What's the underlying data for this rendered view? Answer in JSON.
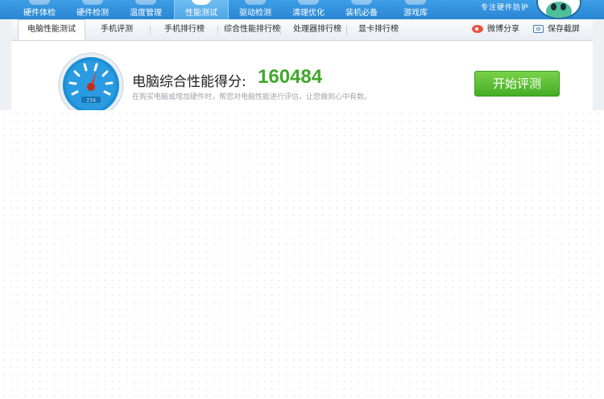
{
  "nav": {
    "items": [
      {
        "label": "硬件体检",
        "icon": "monitor-icon"
      },
      {
        "label": "硬件检测",
        "icon": "hardware-icon"
      },
      {
        "label": "温度管理",
        "icon": "thermometer-icon"
      },
      {
        "label": "性能测试",
        "icon": "speedometer-icon",
        "active": true
      },
      {
        "label": "驱动检测",
        "icon": "driver-icon"
      },
      {
        "label": "清理优化",
        "icon": "broom-icon"
      },
      {
        "label": "装机必备",
        "icon": "shield-icon"
      },
      {
        "label": "游戏库",
        "icon": "gamepad-icon"
      }
    ],
    "slogan": "专注硬件防护",
    "mascot_icon": "mascot-icon"
  },
  "tabs": {
    "items": [
      {
        "label": "电脑性能测试",
        "active": true
      },
      {
        "label": "手机评测"
      },
      {
        "label": "手机排行榜"
      },
      {
        "label": "综合性能排行榜"
      },
      {
        "label": "处理器排行榜"
      },
      {
        "label": "显卡排行榜"
      }
    ],
    "share_label": "微博分享",
    "screenshot_label": "保存截屏"
  },
  "score": {
    "label": "电脑综合性能得分:",
    "value": "160484",
    "description": "在购买电脑或增加硬件时，帮您对电脑性能进行评估，让您做到心中有数。",
    "button_label": "开始评测",
    "gauge_digits": "234"
  },
  "colors": {
    "nav_blue": "#2a86d3",
    "score_green": "#3fa82c",
    "button_green": "#45ad25",
    "gauge_blue": "#1b8fd6",
    "needle_red": "#e23b2a"
  }
}
